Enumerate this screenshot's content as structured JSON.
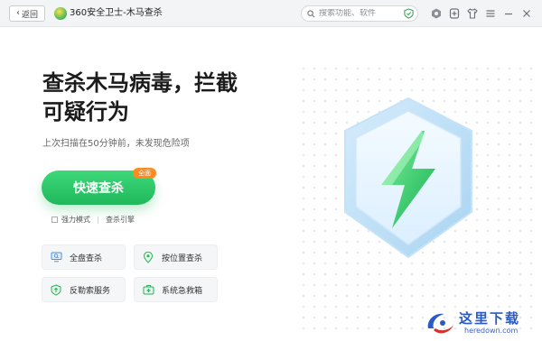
{
  "titlebar": {
    "back_label": "返回",
    "app_title": "360安全卫士-木马查杀",
    "search_placeholder": "搜索功能、软件"
  },
  "icons": {
    "back": "chevron-left-icon",
    "logo": "360-logo-icon",
    "search": "search-icon",
    "search_shield": "shield-check-icon",
    "titlebar": [
      "hexagon-settings-icon",
      "plus-shield-icon",
      "shirt-skin-icon",
      "menu-icon",
      "minimize-icon",
      "close-icon"
    ]
  },
  "hero": {
    "line1": "查杀木马病毒，拦截",
    "line2": "可疑行为"
  },
  "status_text": "上次扫描在50分钟前，未发现危险项",
  "scan_button": {
    "label": "快速查杀",
    "badge": "全面"
  },
  "options": {
    "strong_mode": "强力模式",
    "engine": "查杀引擎"
  },
  "tools": [
    {
      "label": "全盘查杀",
      "icon": "monitor-scan-icon"
    },
    {
      "label": "按位置查杀",
      "icon": "location-pin-icon"
    },
    {
      "label": "反勒索服务",
      "icon": "shield-up-icon"
    },
    {
      "label": "系统急救箱",
      "icon": "first-aid-kit-icon"
    }
  ],
  "watermark": {
    "text": "这里下载",
    "url": "heredown.com"
  },
  "colors": {
    "accent_green": "#1fb85b",
    "badge_orange": "#ff8a1f",
    "shield_blue": "#bfe1f7",
    "bolt_green": "#3fcf6d"
  }
}
